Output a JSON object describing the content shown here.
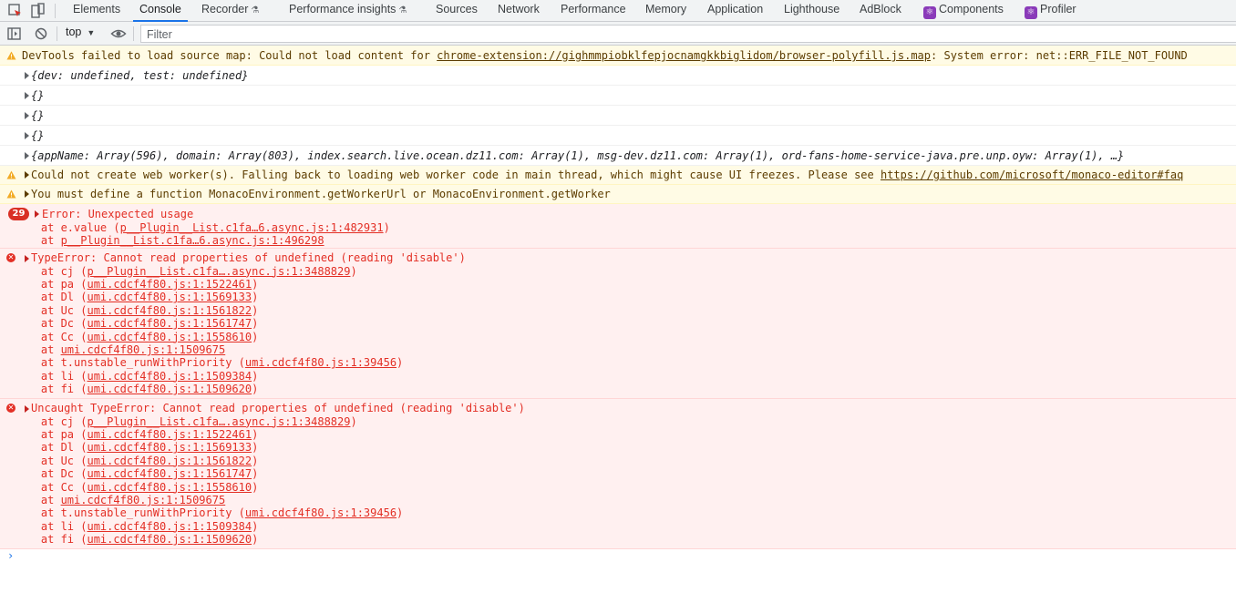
{
  "tabs": [
    {
      "label": "Elements"
    },
    {
      "label": "Console"
    },
    {
      "label": "Recorder"
    },
    {
      "label": "Performance insights"
    },
    {
      "label": "Sources"
    },
    {
      "label": "Network"
    },
    {
      "label": "Performance"
    },
    {
      "label": "Memory"
    },
    {
      "label": "Application"
    },
    {
      "label": "Lighthouse"
    },
    {
      "label": "AdBlock"
    },
    {
      "label": "Components"
    },
    {
      "label": "Profiler"
    }
  ],
  "experimental_icon": "⚗",
  "toolbar": {
    "context": "top",
    "filter_placeholder": "Filter"
  },
  "messages": {
    "warn1_text": "DevTools failed to load source map: Could not load content for ",
    "warn1_link": "chrome-extension://gighmmpiobklfepjocnamgkkbiglidom/browser-polyfill.js.map",
    "warn1_tail": ": System error: net::ERR_FILE_NOT_FOUND",
    "obj1": "{dev: undefined, test: undefined}",
    "obj2": "{}",
    "obj3": "{}",
    "obj4": "{}",
    "obj5": "{appName: Array(596), domain: Array(803), index.search.live.ocean.dz11.com: Array(1), msg-dev.dz11.com: Array(1), ord-fans-home-service-java.pre.unp.oyw: Array(1), …}",
    "warn2_text": "Could not create web worker(s). Falling back to loading web worker code in main thread, which might cause UI freezes. Please see ",
    "warn2_link": "https://github.com/microsoft/monaco-editor#faq",
    "warn3_text": "You must define a function MonacoEnvironment.getWorkerUrl or MonacoEnvironment.getWorker",
    "err1_count": "29",
    "err1_title": "Error: Unexpected usage",
    "err1_l1_pre": "    at e.value (",
    "err1_l1_link": "p__Plugin__List.c1fa…6.async.js:1:482931",
    "err1_l1_post": ")",
    "err1_l2_pre": "    at ",
    "err1_l2_link": "p__Plugin__List.c1fa…6.async.js:1:496298",
    "err2_title": "TypeError: Cannot read properties of undefined (reading 'disable')",
    "err3_title": "Uncaught TypeError: Cannot read properties of undefined (reading 'disable')",
    "stack": [
      {
        "pre": "    at cj (",
        "link": "p__Plugin__List.c1fa….async.js:1:3488829",
        "post": ")"
      },
      {
        "pre": "    at pa (",
        "link": "umi.cdcf4f80.js:1:1522461",
        "post": ")"
      },
      {
        "pre": "    at Dl (",
        "link": "umi.cdcf4f80.js:1:1569133",
        "post": ")"
      },
      {
        "pre": "    at Uc (",
        "link": "umi.cdcf4f80.js:1:1561822",
        "post": ")"
      },
      {
        "pre": "    at Dc (",
        "link": "umi.cdcf4f80.js:1:1561747",
        "post": ")"
      },
      {
        "pre": "    at Cc (",
        "link": "umi.cdcf4f80.js:1:1558610",
        "post": ")"
      },
      {
        "pre": "    at ",
        "link": "umi.cdcf4f80.js:1:1509675",
        "post": ""
      },
      {
        "pre": "    at t.unstable_runWithPriority (",
        "link": "umi.cdcf4f80.js:1:39456",
        "post": ")"
      },
      {
        "pre": "    at li (",
        "link": "umi.cdcf4f80.js:1:1509384",
        "post": ")"
      },
      {
        "pre": "    at fi (",
        "link": "umi.cdcf4f80.js:1:1509620",
        "post": ")"
      }
    ]
  },
  "prompt": "›"
}
